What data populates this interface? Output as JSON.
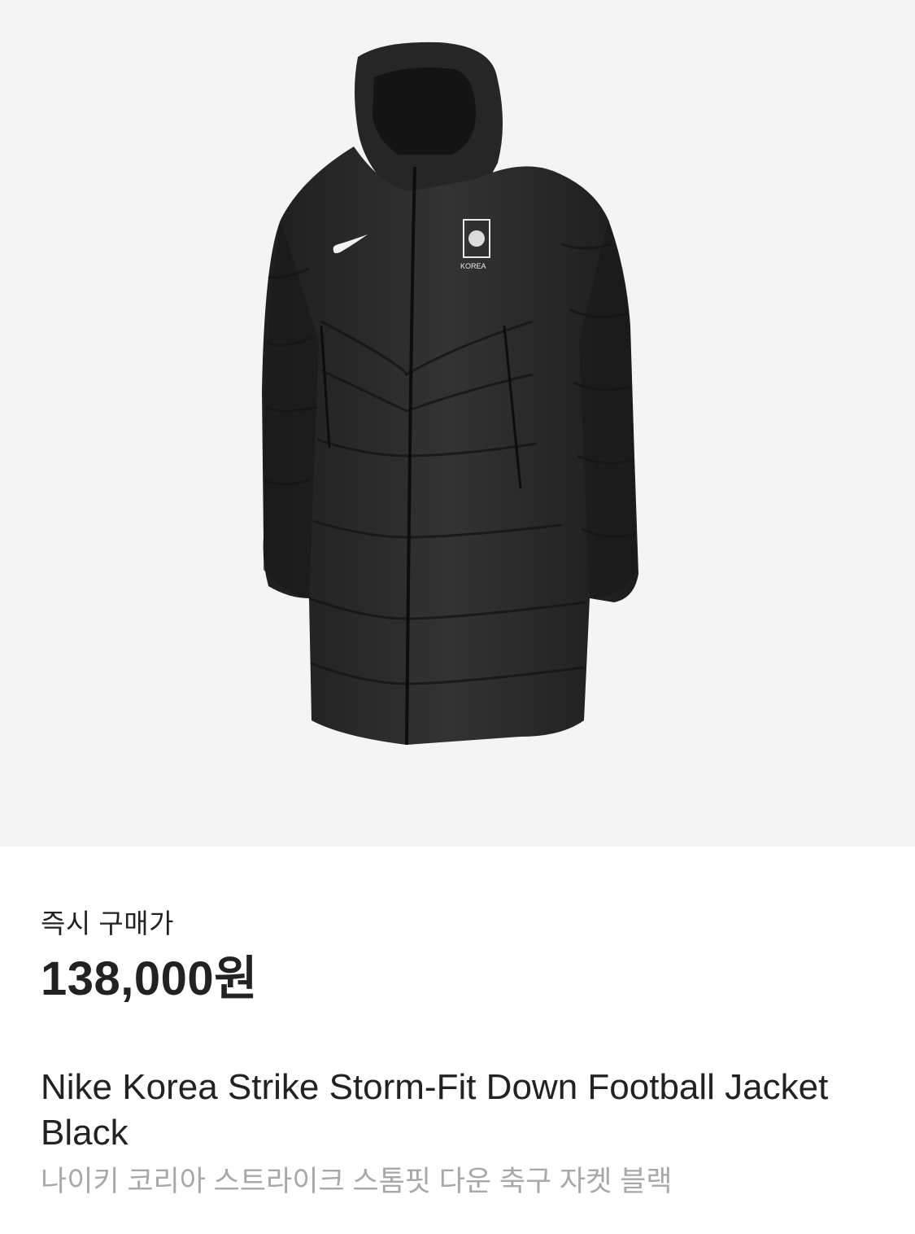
{
  "product": {
    "image_alt": "Nike Korea Strike Storm-Fit Down Football Jacket Black product image",
    "badge_text": "KOREA"
  },
  "pricing": {
    "label": "즉시 구매가",
    "price": "138,000원"
  },
  "title": {
    "english": "Nike Korea Strike Storm-Fit Down Football Jacket Black",
    "korean": "나이키 코리아 스트라이크 스톰핏 다운 축구 자켓 블랙"
  },
  "colors": {
    "hero_background": "#f4f4f4",
    "jacket": "#2b2b2b",
    "text_primary": "#222222",
    "text_secondary": "#a8a8a8"
  }
}
